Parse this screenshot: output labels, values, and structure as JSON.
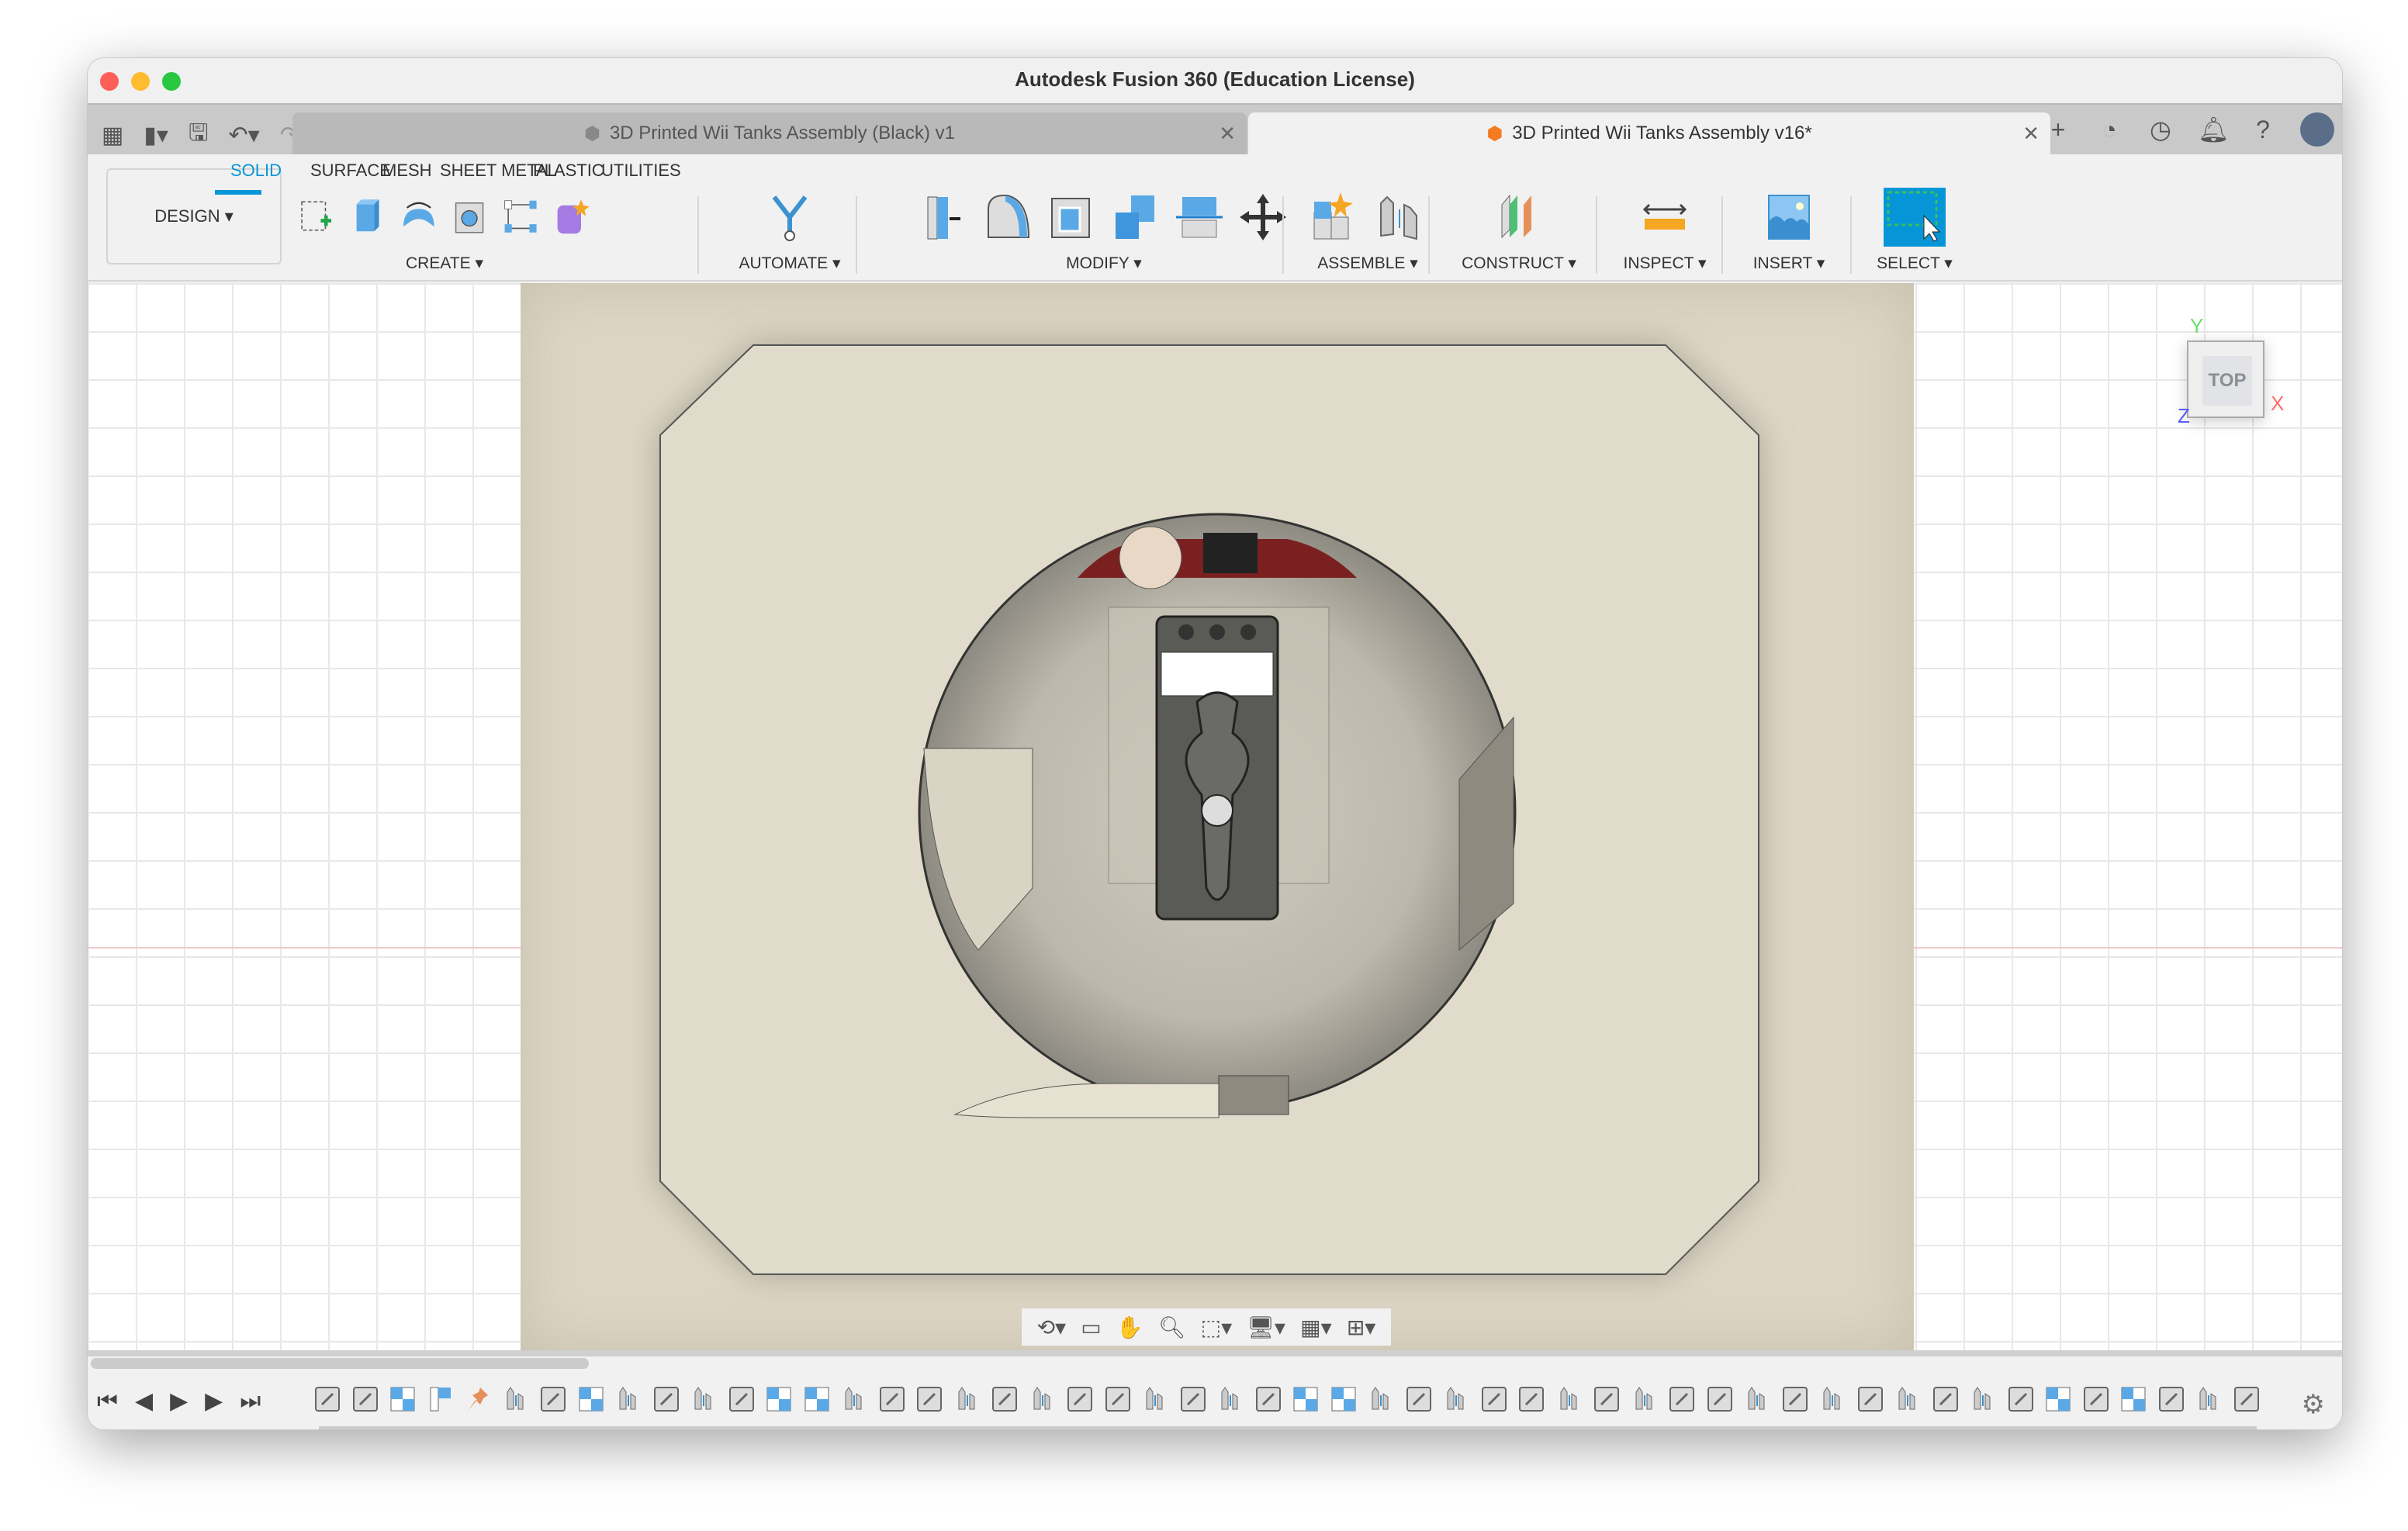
{
  "window": {
    "title": "Autodesk Fusion 360 (Education License)"
  },
  "tabs": [
    {
      "label": "3D Printed Wii Tanks Assembly (Black) v1",
      "active": false
    },
    {
      "label": "3D Printed Wii Tanks Assembly v16*",
      "active": true
    }
  ],
  "ribbon": {
    "workspace": "DESIGN ▾",
    "tabs": [
      "SOLID",
      "SURFACE",
      "MESH",
      "SHEET METAL",
      "PLASTIC",
      "UTILITIES"
    ],
    "groups": {
      "create": "CREATE ▾",
      "automate": "AUTOMATE ▾",
      "modify": "MODIFY ▾",
      "assemble": "ASSEMBLE ▾",
      "construct": "CONSTRUCT ▾",
      "inspect": "INSPECT ▾",
      "insert": "INSERT ▾",
      "select": "SELECT ▾"
    }
  },
  "viewcube": {
    "face": "TOP",
    "x": "X",
    "y": "Y",
    "z": "Z"
  },
  "colors": {
    "accent": "#0696d7",
    "axis_x": "#ff6b6b",
    "axis_y": "#6be06b",
    "axis_z": "#5a5aff"
  },
  "timeline": {
    "items": [
      "joint",
      "joint",
      "rigid-group",
      "as-built",
      "pin",
      "motion-link",
      "joint",
      "rigid-group",
      "motion-link",
      "joint",
      "motion-link",
      "joint",
      "rigid-group",
      "rigid-group",
      "motion-link",
      "joint",
      "joint",
      "motion-link",
      "joint",
      "motion-link",
      "joint",
      "joint",
      "motion-link",
      "joint",
      "motion-link",
      "joint",
      "rigid-group",
      "rigid-group",
      "motion-link",
      "joint",
      "motion-link",
      "joint",
      "joint",
      "motion-link",
      "joint",
      "motion-link",
      "joint",
      "joint",
      "motion-link",
      "joint",
      "motion-link",
      "joint",
      "motion-link",
      "joint",
      "motion-link",
      "joint",
      "rigid-group",
      "joint",
      "rigid-group",
      "joint",
      "motion-link",
      "joint"
    ]
  }
}
